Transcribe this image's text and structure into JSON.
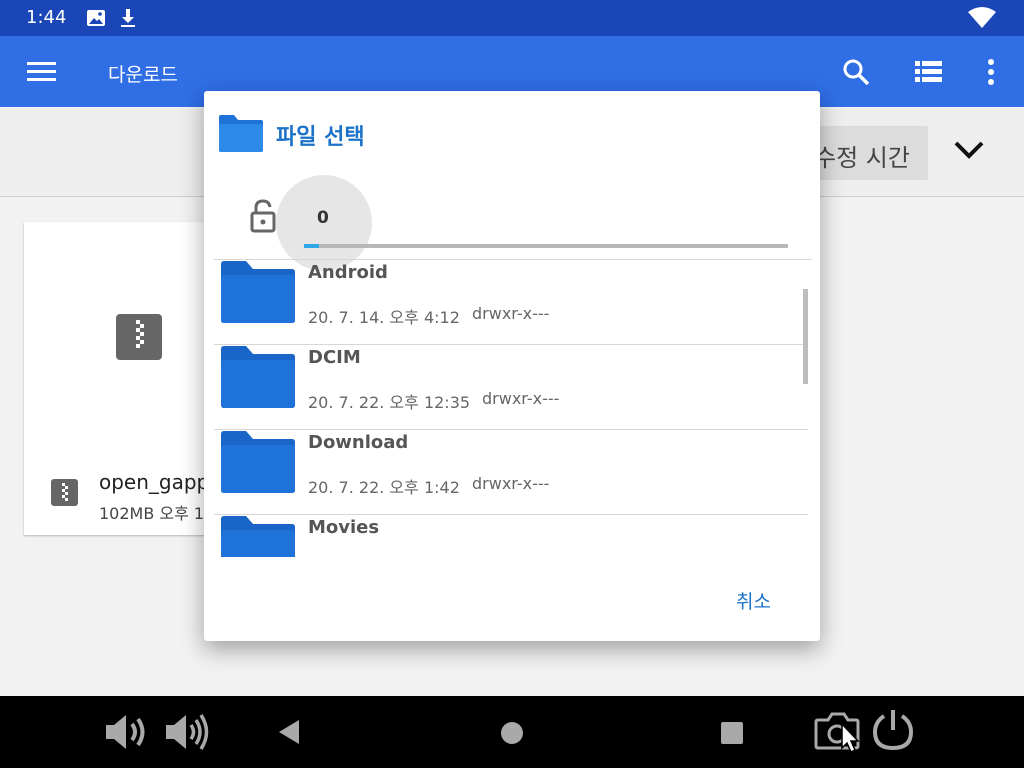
{
  "status_bar": {
    "time": "1:44",
    "icons": [
      "image-icon",
      "download-icon",
      "wifi-icon"
    ]
  },
  "app_bar": {
    "title": "다운로드",
    "icons": [
      "menu-icon",
      "search-icon",
      "list-view-icon",
      "more-vert-icon"
    ]
  },
  "sort_bar": {
    "sort_label": "수정 시간",
    "icon": "chevron-down-icon"
  },
  "file_card": {
    "name": "open_gapp",
    "meta": "102MB 오후 1",
    "icon": "zip-file-icon"
  },
  "dialog": {
    "title": "파일 선택",
    "seek_value": "0",
    "seek_progress": 0.03,
    "items": [
      {
        "name": "Android",
        "date": "20. 7. 14. 오후 4:12",
        "perm": "drwxr-x---"
      },
      {
        "name": "DCIM",
        "date": "20. 7. 22. 오후 12:35",
        "perm": "drwxr-x---"
      },
      {
        "name": "Download",
        "date": "20. 7. 22. 오후 1:42",
        "perm": "drwxr-x---"
      },
      {
        "name": "Movies",
        "date": "",
        "perm": ""
      }
    ],
    "cancel_label": "취소"
  },
  "nav_bar": {
    "icons": [
      "volume-down-icon",
      "volume-up-icon",
      "back-icon",
      "home-icon",
      "recents-icon",
      "screenshot-icon",
      "power-icon"
    ]
  },
  "colors": {
    "status_bar": "#1a46b8",
    "app_bar": "#2f6ee5",
    "accent": "#1c73c9",
    "folder": "#1f73d8"
  }
}
